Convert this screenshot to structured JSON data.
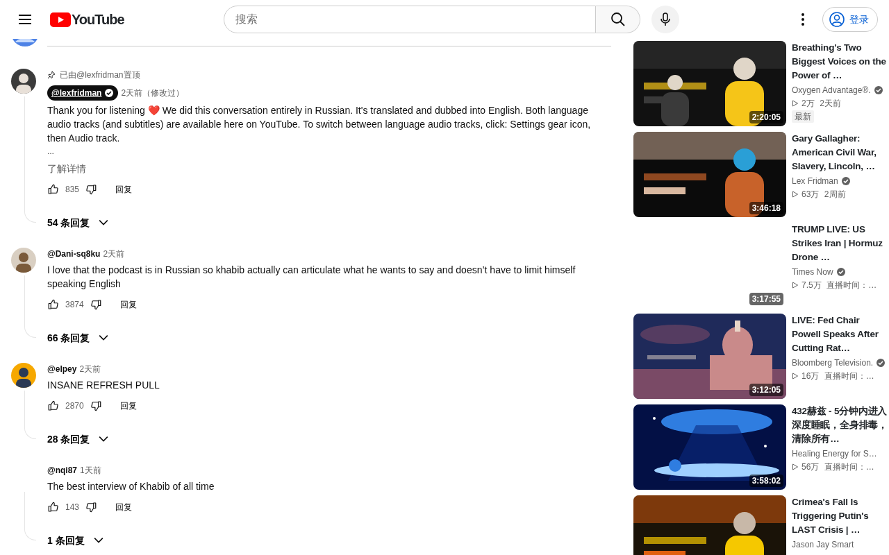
{
  "header": {
    "logo": "YouTube",
    "search": {
      "placeholder": "搜索"
    },
    "sign_in": "登录"
  },
  "comments": [
    {
      "avatar": true,
      "pinned_by": "已由@lexfridman置顶",
      "author": "@lexfridman",
      "author_highlighted": true,
      "verified": true,
      "time": "2天前（修改过）",
      "text": "Thank you for listening ❤️ We did this conversation entirely in Russian. It's translated and dubbed into English. Both language audio tracks (and subtitles) are available here on YouTube. To switch between language audio tracks, click: Settings gear icon, then Audio track.",
      "truncation": "…",
      "read_more": "了解详情",
      "likes": "835",
      "reply": "回复",
      "replies": "54 条回复"
    },
    {
      "avatar": true,
      "author": "@Dani-sq8ku",
      "author_highlighted": false,
      "verified": false,
      "time": "2天前",
      "text": "I love that the podcast is in Russian so khabib actually can articulate what he wants to say and doesn’t have to limit himself speaking English",
      "likes": "3874",
      "reply": "回复",
      "replies": "66 条回复"
    },
    {
      "avatar": true,
      "author": "@elpey",
      "author_highlighted": false,
      "verified": false,
      "time": "2天前",
      "text": "INSANE REFRESH PULL",
      "likes": "2870",
      "reply": "回复",
      "replies": "28 条回复"
    },
    {
      "avatar": false,
      "author": "@nqi87",
      "author_highlighted": false,
      "verified": false,
      "time": "1天前",
      "text": "The best interview of Khabib of all time",
      "likes": "143",
      "reply": "回复",
      "replies": "1 条回复"
    }
  ],
  "related_videos": [
    {
      "has_thumbnail": true,
      "duration": "2:20:05",
      "title": "Breathing's Two Biggest Voices on the Power of …",
      "channel": "Oxygen Advantage®.",
      "verified": true,
      "views": "2万",
      "age": "2天前",
      "badge": "最新"
    },
    {
      "has_thumbnail": true,
      "duration": "3:46:18",
      "title": "Gary Gallagher: American Civil War, Slavery, Lincoln, …",
      "channel": "Lex Fridman",
      "verified": true,
      "views": "63万",
      "age": "2周前"
    },
    {
      "has_thumbnail": false,
      "duration": "3:17:55",
      "title": "TRUMP LIVE: US Strikes Iran | Hormuz Drone …",
      "channel": "Times Now",
      "verified": true,
      "views": "7.5万",
      "age": "直播时间：…"
    },
    {
      "has_thumbnail": true,
      "duration": "3:12:05",
      "title": "LIVE: Fed Chair Powell Speaks After Cutting Rat…",
      "channel": "Bloomberg Television.",
      "verified": true,
      "views": "16万",
      "age": "直播时间：…"
    },
    {
      "has_thumbnail": true,
      "duration": "3:58:02",
      "title": "432赫兹 - 5分钟内进入深度睡眠，全身排毒，清除所有…",
      "channel": "Healing Energy for S…",
      "verified": false,
      "views": "56万",
      "age": "直播时间：…"
    },
    {
      "has_thumbnail": true,
      "title": "Crimea's Fall Is Triggering Putin's LAST Crisis | …",
      "channel": "Jason Jay Smart",
      "verified": false
    }
  ]
}
